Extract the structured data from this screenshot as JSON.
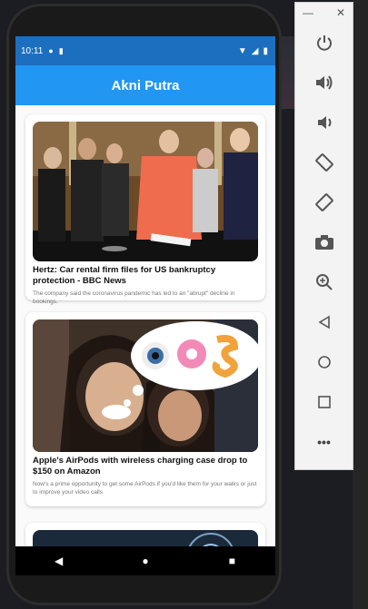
{
  "status_bar": {
    "time": "10:11"
  },
  "app_bar": {
    "title": "Akni Putra"
  },
  "articles": [
    {
      "title": "Hertz: Car rental firm files for US bankruptcy protection - BBC News",
      "description": "The company said the coronavirus pandemic has led to an \"abrupt\" decline in bookings."
    },
    {
      "title": "Apple's AirPods with wireless charging case drop to $150 on Amazon",
      "description": "Now's a prime opportunity to get some AirPods if you'd like them for your walks or just to improve your video calls"
    }
  ],
  "emulator_panel": {
    "buttons": [
      "power-icon",
      "volume-up-icon",
      "volume-down-icon",
      "rotate-left-icon",
      "rotate-right-icon",
      "camera-icon",
      "zoom-icon",
      "back-icon",
      "home-icon",
      "overview-icon",
      "more-icon"
    ]
  },
  "colors": {
    "app_bar": "#2196f3",
    "status_bar": "#1c6fbf"
  }
}
